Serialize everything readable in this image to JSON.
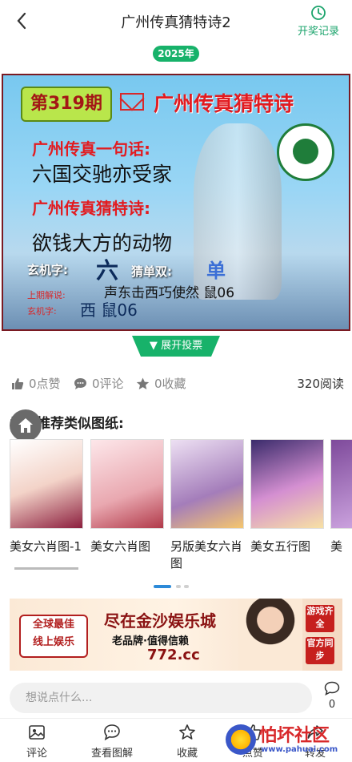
{
  "header": {
    "title": "广州传真猜特诗2",
    "history_label": "开奖记录"
  },
  "year_badge": "2025年",
  "poster": {
    "issue": "第319期",
    "headline": "广州传真猜特诗",
    "line1_label": "广州传真一句话:",
    "line1_text": "六国交驰亦受家",
    "line2_label": "广州传真猜特诗:",
    "line2_text": "欲钱大方的动物",
    "xuanji_label": "玄机字:",
    "xuanji_value": "六",
    "cai_label": "猜单双:",
    "cai_value": "单",
    "prev_label": "上期解说:",
    "prev_riddle": "声东击西巧使然 鼠06",
    "prev_xuanji_label": "玄机字:",
    "prev_answer": "西 鼠06"
  },
  "vote_label": "展开投票",
  "stats": {
    "likes": "0点赞",
    "comments": "0评论",
    "favorites": "0收藏",
    "reads": "320阅读"
  },
  "recommend": {
    "title": "为您推荐类似图纸:",
    "items": [
      {
        "caption": "美女六肖图-1"
      },
      {
        "caption": "美女六肖图"
      },
      {
        "caption": "另版美女六肖图"
      },
      {
        "caption": "美女五行图"
      },
      {
        "caption": "美"
      }
    ]
  },
  "banner": {
    "left_line1": "全球最佳",
    "left_line2": "线上娱乐",
    "main": "尽在金沙娱乐城",
    "sub": "老品牌·值得信赖",
    "url": "772.cc",
    "right1": "游戏齐全",
    "right2": "官方同步"
  },
  "comment": {
    "placeholder": "想说点什么...",
    "count": "0"
  },
  "tabs": [
    {
      "label": "评论"
    },
    {
      "label": "查看图解"
    },
    {
      "label": "收藏"
    },
    {
      "label": "点赞"
    },
    {
      "label": "转发"
    }
  ],
  "watermark": {
    "text": "怕坏社区",
    "url": "www.pahuai.com"
  },
  "colors": {
    "accent": "#17b26a",
    "poster_border": "#7a1a22",
    "red": "#e21b20"
  }
}
